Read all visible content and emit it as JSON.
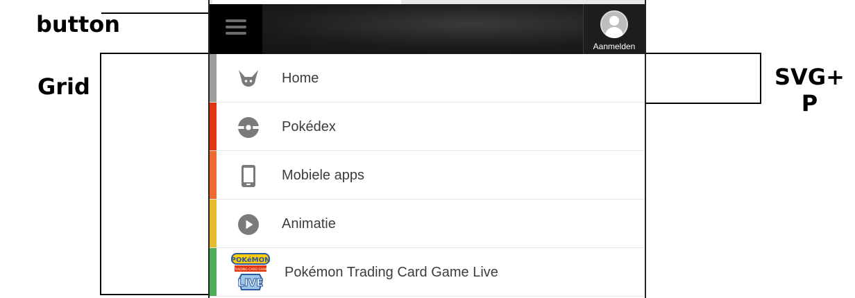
{
  "annotations": {
    "button": "button",
    "grid": "Grid",
    "svg_p_line1": "SVG+",
    "svg_p_line2": "P"
  },
  "header": {
    "login_label": "Aanmelden"
  },
  "menu": {
    "items": [
      {
        "label": "Home",
        "icon": "pikachu-ears-icon",
        "stripe_color": "#9e9e9e"
      },
      {
        "label": "Pokédex",
        "icon": "pokeball-icon",
        "stripe_color": "#e3350d"
      },
      {
        "label": "Mobiele apps",
        "icon": "smartphone-icon",
        "stripe_color": "#ee6b2f"
      },
      {
        "label": "Animatie",
        "icon": "play-icon",
        "stripe_color": "#e6bc2f"
      },
      {
        "label": "Pokémon Trading Card Game Live",
        "icon": "pokemon-tcg-live-logo",
        "stripe_color": "#4dad5b"
      }
    ]
  },
  "logo": {
    "top_text": "POKéMON",
    "band_text": "TRADING CARD GAME",
    "bottom_text": "LIVE"
  },
  "colors": {
    "icon_gray": "#7a7a7a",
    "header_dark": "#1b1b1b"
  }
}
